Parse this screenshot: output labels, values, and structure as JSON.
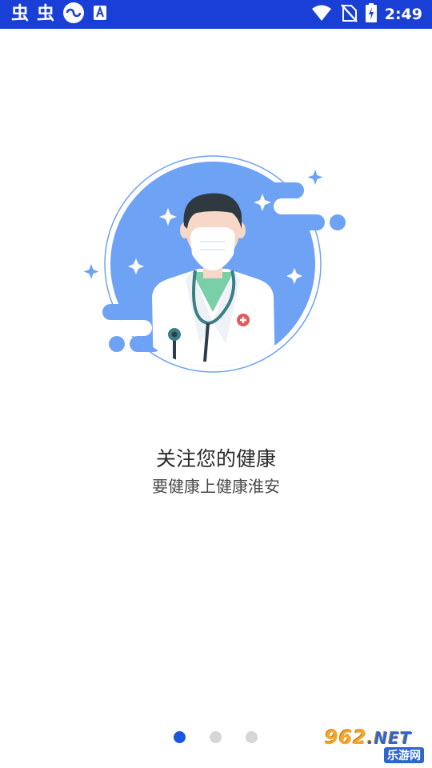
{
  "status_bar": {
    "left_glyphs": [
      "虫",
      "虫"
    ],
    "icons": [
      "carrier-icon",
      "app-notification-icon",
      "wifi-icon",
      "no-sim-icon",
      "battery-charging-icon"
    ],
    "time": "2:49"
  },
  "onboarding": {
    "title": "关注您的健康",
    "subtitle": "要健康上健康淮安",
    "page_count": 3,
    "current_page": 1
  },
  "watermark": {
    "number": "962",
    "suffix": ".NET",
    "label": "乐游网"
  },
  "colors": {
    "status_bar": "#1a3fd6",
    "illustration_blue": "#6ea2f5",
    "dot_active": "#1a56e0",
    "dot_inactive": "#d6d6d6"
  }
}
